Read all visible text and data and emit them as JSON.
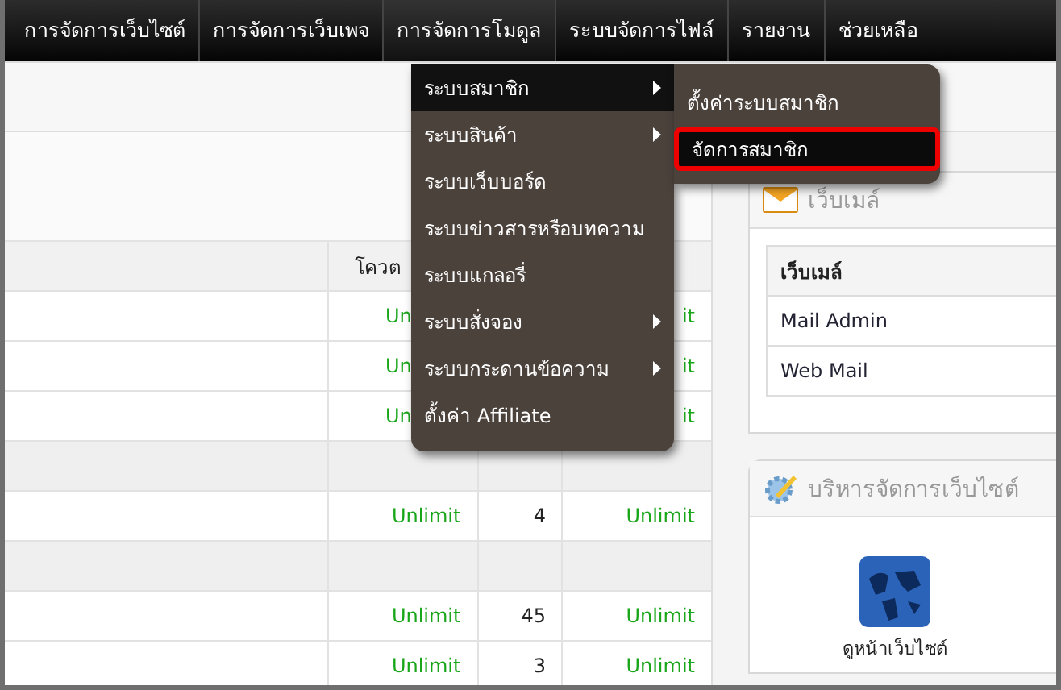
{
  "nav": {
    "items": [
      {
        "label": "การจัดการเว็บไซต์",
        "selected": false
      },
      {
        "label": "การจัดการเว็บเพจ",
        "selected": false
      },
      {
        "label": "การจัดการโมดูล",
        "selected": true
      },
      {
        "label": "ระบบจัดการไฟล์",
        "selected": false
      },
      {
        "label": "รายงาน",
        "selected": false
      },
      {
        "label": "ช่วยเหลือ",
        "selected": false
      }
    ]
  },
  "dropdown": {
    "items": [
      {
        "label": "ระบบสมาชิก",
        "has_submenu": true,
        "selected": true
      },
      {
        "label": "ระบบสินค้า",
        "has_submenu": true,
        "selected": false
      },
      {
        "label": "ระบบเว็บบอร์ด",
        "has_submenu": false,
        "selected": false
      },
      {
        "label": "ระบบข่าวสารหรือบทความ",
        "has_submenu": false,
        "selected": false
      },
      {
        "label": "ระบบแกลอรี่",
        "has_submenu": false,
        "selected": false
      },
      {
        "label": "ระบบสั่งจอง",
        "has_submenu": true,
        "selected": false
      },
      {
        "label": "ระบบกระดานข้อความ",
        "has_submenu": true,
        "selected": false
      },
      {
        "label": "ตั้งค่า Affiliate",
        "has_submenu": false,
        "selected": false
      }
    ],
    "submenu": [
      {
        "label": "ตั้งค่าระบบสมาชิก",
        "selected": false
      },
      {
        "label": "จัดการสมาชิก",
        "selected": true
      }
    ]
  },
  "quota_table": {
    "columns": [
      "โควต"
    ],
    "rows": [
      {
        "kind": "covered",
        "quota": "Un",
        "remaining": "it"
      },
      {
        "kind": "covered",
        "quota": "Un",
        "remaining": "it"
      },
      {
        "kind": "covered",
        "quota": "Un",
        "remaining": "it"
      },
      {
        "kind": "group"
      },
      {
        "kind": "data",
        "quota": "Unlimit",
        "used": "4",
        "remaining": "Unlimit"
      },
      {
        "kind": "group"
      },
      {
        "kind": "data",
        "quota": "Unlimit",
        "used": "45",
        "remaining": "Unlimit"
      },
      {
        "kind": "data",
        "quota": "Unlimit",
        "used": "3",
        "remaining": "Unlimit"
      }
    ]
  },
  "webmail": {
    "title": "เว็บเมล์",
    "header": "เว็บเมล์",
    "links": [
      "Mail Admin",
      "Web Mail"
    ]
  },
  "site_admin": {
    "title": "บริหารจัดการเว็บไซต์",
    "shortcut": "ดูหน้าเว็บไซต์"
  }
}
